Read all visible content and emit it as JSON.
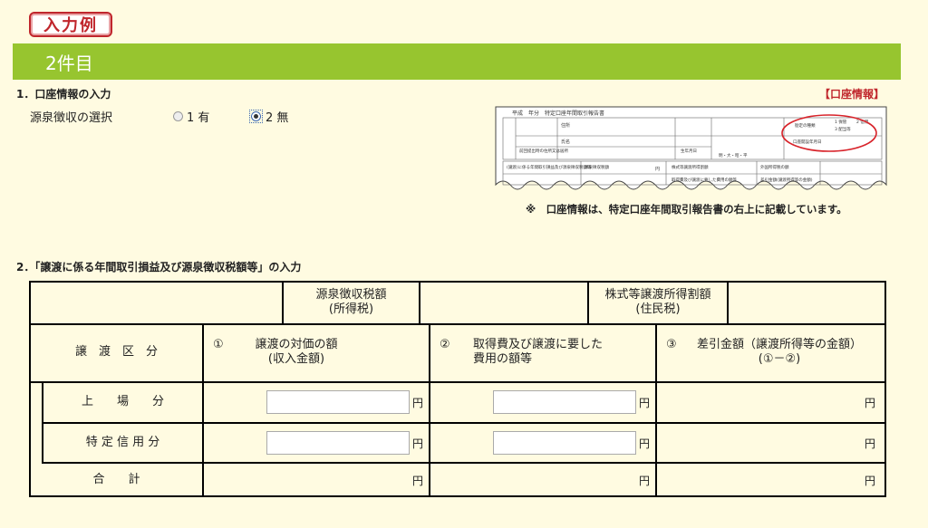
{
  "badge": "入力例",
  "section_title": "2件目",
  "section1": {
    "heading": "1．口座情報の入力",
    "right_label": "【口座情報】",
    "gensen_label": "源泉徴収の選択",
    "options": [
      {
        "label": "1 有",
        "checked": false
      },
      {
        "label": "2 無",
        "checked": true
      }
    ],
    "note": "※　口座情報は、特定口座年間取引報告書の右上に記載しています。"
  },
  "thumbnail": {
    "title": "平成　年分　特定口座年間取引報告書",
    "rows": [
      "住所",
      "氏名",
      "前回提出時の住所又は居所",
      "生年月日"
    ],
    "account_type": "勘定の種類",
    "account_opts": [
      "1 保管",
      "2 信用",
      "3 配当等"
    ],
    "open_date": "口座開設年月日",
    "era": "明・大・昭・平",
    "lower": [
      "(譲渡)に係る年間取引損益及び源泉徴収税額等",
      "源泉徴収税額",
      "株式等譲渡所得割額",
      "外国所得税の額",
      "取得費及び譲渡に要した費用の額等",
      "差引金額(譲渡所得等の金額)"
    ],
    "yen": "円"
  },
  "section2": {
    "heading": "2．「譲渡に係る年間取引損益及び源泉徴収税額等」の入力"
  },
  "table": {
    "header1": {
      "gensen": "源泉徴収税額",
      "gensen_sub": "(所得税)",
      "kabushiki": "株式等譲渡所得割額",
      "kabushiki_sub": "(住民税)"
    },
    "header2": {
      "kubun": "譲　渡　区　分",
      "col1_num": "①",
      "col1_a": "譲渡の対価の額",
      "col1_b": "(収入金額)",
      "col2_num": "②",
      "col2_a": "取得費及び譲渡に要した",
      "col2_b": "費用の額等",
      "col3_num": "③",
      "col3_a": "差引金額（譲渡所得等の金額）",
      "col3_b": "(①－②)"
    },
    "rows": [
      {
        "label": "上　　場　　分",
        "v1": "",
        "v2": ""
      },
      {
        "label": "特 定 信 用 分",
        "v1": "",
        "v2": ""
      },
      {
        "label": "合　　計"
      }
    ],
    "yen": "円"
  }
}
